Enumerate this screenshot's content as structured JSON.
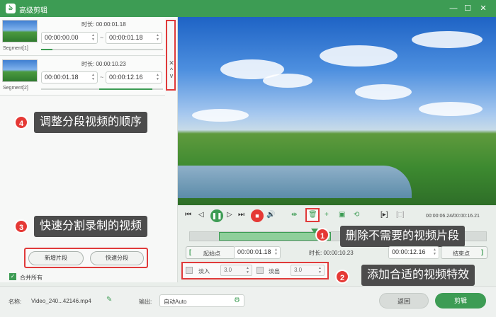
{
  "window": {
    "title": "高级剪辑",
    "logo": "ঌ",
    "minimize": "—",
    "maximize": "☐",
    "close": "✕"
  },
  "segments": [
    {
      "label": "Segment[1]",
      "duration": "时长: 00:00:01.18",
      "start": "00:00:00.00",
      "end": "00:00:01.18",
      "sep": "~"
    },
    {
      "label": "Segment[2]",
      "duration": "时长: 00:00:10.23",
      "start": "00:00:01.18",
      "end": "00:00:12.16",
      "sep": "~"
    }
  ],
  "reorder": {
    "remove": "✕",
    "up": "^",
    "down": "v"
  },
  "callouts": {
    "c1": {
      "num": "1",
      "text": "删除不需要的视频片段"
    },
    "c2": {
      "num": "2",
      "text": "添加合适的视频特效"
    },
    "c3": {
      "num": "3",
      "text": "快速分割录制的视频"
    },
    "c4": {
      "num": "4",
      "text": "调整分段视频的顺序"
    }
  },
  "left_actions": {
    "new_segment": "新增片段",
    "quick_split": "快速分段",
    "merge_all": "合并所有"
  },
  "player": {
    "time": "00:00:06.24/00:00:16.21"
  },
  "trim": {
    "start_btn": "起始点",
    "start_value": "00:00:01.18",
    "duration": "时长: 00:00:10.23",
    "end_value": "00:00:12.16",
    "end_btn": "结束点"
  },
  "effects": {
    "fade_in": "淡入",
    "fade_in_value": "3.0",
    "fade_out": "淡出",
    "fade_out_value": "3.0"
  },
  "bottom": {
    "name_label": "名称:",
    "name_value": "Video_240...42146.mp4",
    "output_label": "输出:",
    "output_value": "自动Auto",
    "back": "返回",
    "edit": "剪辑"
  },
  "colors": {
    "brand": "#3d9c54",
    "highlight": "#e03a3a",
    "callout_bg": "#4c4c4c"
  }
}
